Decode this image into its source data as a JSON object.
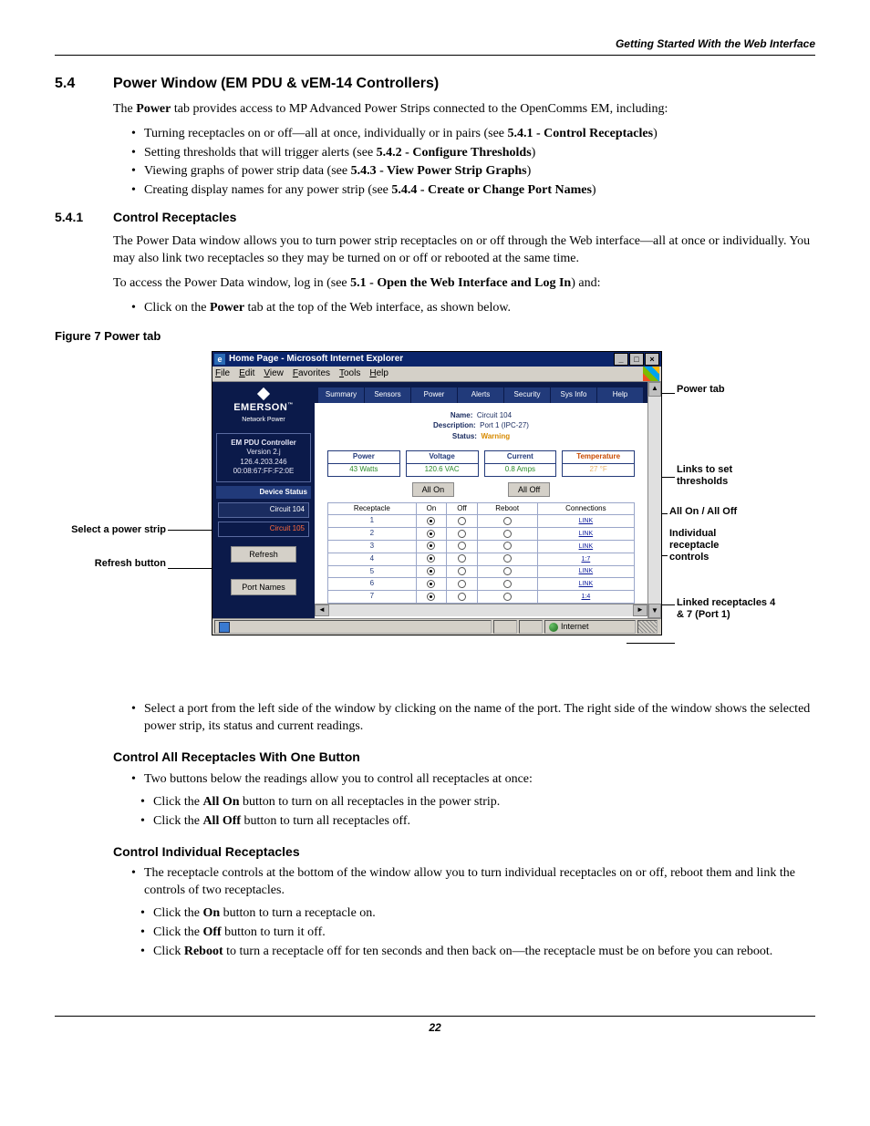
{
  "running_head": "Getting Started With the Web Interface",
  "sec54": {
    "num": "5.4",
    "title": "Power Window (EM PDU & vEM-14 Controllers)",
    "intro_a": "The ",
    "intro_b": "Power",
    "intro_c": " tab provides access to MP Advanced Power Strips connected to the OpenComms EM, including:",
    "b1a": "Turning receptacles on or off—all at once, individually or in pairs (see ",
    "b1b": "5.4.1 - Control Receptacles",
    "b1c": ")",
    "b2a": "Setting thresholds that will trigger alerts (see ",
    "b2b": "5.4.2 - Configure Thresholds",
    "b2c": ")",
    "b3a": "Viewing graphs of power strip data (see ",
    "b3b": "5.4.3 - View Power Strip Graphs",
    "b3c": ")",
    "b4a": "Creating display names for any power strip (see ",
    "b4b": "5.4.4 - Create or Change Port Names",
    "b4c": ")"
  },
  "sec541": {
    "num": "5.4.1",
    "title": "Control Receptacles",
    "p1": "The Power Data window allows you to turn power strip receptacles on or off through the Web interface—all at once or individually. You may also link two receptacles so they may be turned on or off or rebooted at the same time.",
    "p2a": "To access the Power Data window, log in (see ",
    "p2b": "5.1 - Open the Web Interface and Log In",
    "p2c": ") and:",
    "b1a": "Click on the ",
    "b1b": "Power",
    "b1c": " tab at the top of the Web interface, as shown below."
  },
  "fig7": "Figure 7    Power tab",
  "labels": {
    "l_select": "Select a power strip",
    "l_refresh": "Refresh button",
    "r_powertab": "Power tab",
    "r_links": "Links to set thresholds",
    "r_allon": "All On / All Off",
    "r_indiv": "Individual receptacle controls",
    "r_linked": "Linked receptacles 4 & 7 (Port 1)"
  },
  "ie": {
    "title": "Home Page - Microsoft Internet Explorer",
    "menu": {
      "file": "File",
      "edit": "Edit",
      "view": "View",
      "fav": "Favorites",
      "tools": "Tools",
      "help": "Help"
    },
    "brand1": "EMERSON",
    "brand_tm": "™",
    "brand2": "Network Power",
    "ctrl": {
      "l1": "EM PDU Controller",
      "l2": "Version 2.j",
      "l3": "126.4.203.246",
      "l4": "00:08:67:FF:F2:0E"
    },
    "device_status": "Device Status",
    "circuit1": "Circuit 104",
    "circuit2": "Circuit 105",
    "btn_refresh": "Refresh",
    "btn_portnames": "Port Names",
    "tabs": {
      "summary": "Summary",
      "sensors": "Sensors",
      "power": "Power",
      "alerts": "Alerts",
      "security": "Security",
      "sysinfo": "Sys Info",
      "help": "Help"
    },
    "info": {
      "name_k": "Name:",
      "name_v": "Circuit 104",
      "desc_k": "Description:",
      "desc_v": "Port 1 (IPC-27)",
      "stat_k": "Status:",
      "stat_v": "Warning"
    },
    "metrics": {
      "power_h": "Power",
      "power_v": "43 Watts",
      "volt_h": "Voltage",
      "volt_v": "120.6 VAC",
      "curr_h": "Current",
      "curr_v": "0.8 Amps",
      "temp_h": "Temperature",
      "temp_v": "27 °F"
    },
    "all_on": "All On",
    "all_off": "All Off",
    "th": {
      "rec": "Receptacle",
      "on": "On",
      "off": "Off",
      "reboot": "Reboot",
      "conn": "Connections"
    },
    "rows": [
      {
        "n": "1",
        "link": "LINK"
      },
      {
        "n": "2",
        "link": "LINK"
      },
      {
        "n": "3",
        "link": "LINK"
      },
      {
        "n": "4",
        "link": "1:7"
      },
      {
        "n": "5",
        "link": "LINK"
      },
      {
        "n": "6",
        "link": "LINK"
      },
      {
        "n": "7",
        "link": "1:4"
      }
    ],
    "status_internet": "Internet"
  },
  "after": {
    "b1": "Select a port from the left side of the window by clicking on the name of the port. The right side of the window shows the selected power strip, its status and current readings.",
    "h1": "Control All Receptacles With One Button",
    "h1_b1": "Two buttons below the readings allow you to control all receptacles at once:",
    "h1_s1a": "Click the ",
    "h1_s1b": "All On",
    "h1_s1c": " button to turn on all receptacles in the power strip.",
    "h1_s2a": "Click the ",
    "h1_s2b": "All Off",
    "h1_s2c": " button to turn all receptacles off.",
    "h2": "Control Individual Receptacles",
    "h2_b1": "The receptacle controls at the bottom of the window allow you to turn individual receptacles on or off, reboot them and link the controls of two receptacles.",
    "h2_s1a": "Click the ",
    "h2_s1b": "On",
    "h2_s1c": " button to turn a receptacle on.",
    "h2_s2a": "Click the ",
    "h2_s2b": "Off",
    "h2_s2c": " button to turn it off.",
    "h2_s3a": "Click ",
    "h2_s3b": "Reboot",
    "h2_s3c": " to turn a receptacle off for ten seconds and then back on—the receptacle must be on before you can reboot."
  },
  "page_num": "22"
}
